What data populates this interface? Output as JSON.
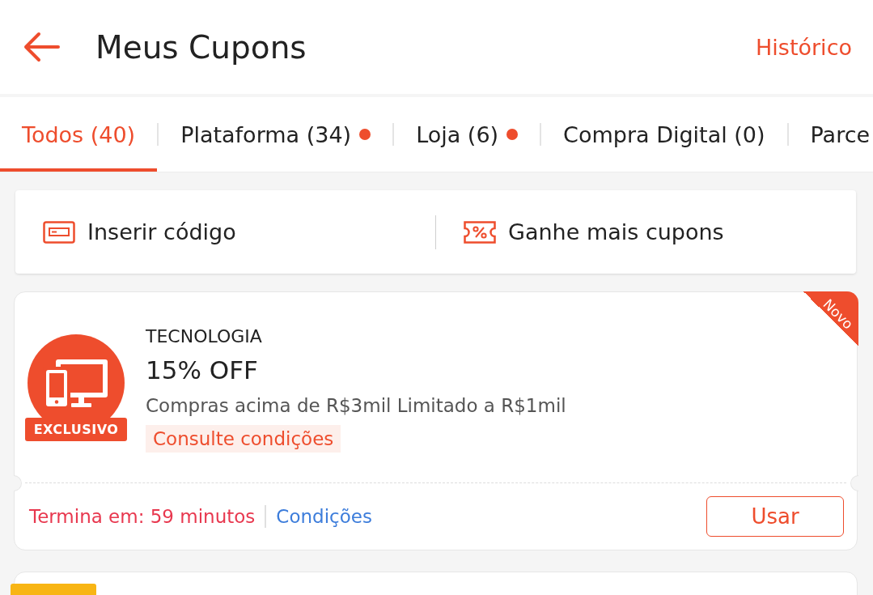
{
  "header": {
    "title": "Meus Cupons",
    "action": "Histórico"
  },
  "tabs": [
    {
      "label": "Todos (40)",
      "selected": true,
      "unread": false
    },
    {
      "label": "Plataforma (34)",
      "selected": false,
      "unread": true
    },
    {
      "label": "Loja (6)",
      "selected": false,
      "unread": true
    },
    {
      "label": "Compra Digital (0)",
      "selected": false,
      "unread": false
    },
    {
      "label": "Parce",
      "selected": false,
      "unread": false
    }
  ],
  "code_bar": {
    "actions": [
      {
        "kind": "code",
        "label": "Inserir código"
      },
      {
        "kind": "earn",
        "label": "Ganhe mais cupons"
      }
    ]
  },
  "coupons": [
    {
      "badge": "EXCLUSIVO",
      "ribbon": "Novo",
      "category": "TECNOLOGIA",
      "discount": "15% OFF",
      "terms": "Compras acima de R$3mil Limitado a R$1mil",
      "conditions_tag": "Consulte condições",
      "expiry": "Termina em: 59 minutos",
      "conditions_link": "Condições",
      "button": "Usar"
    }
  ],
  "next_coupon": {
    "tag": true
  }
}
